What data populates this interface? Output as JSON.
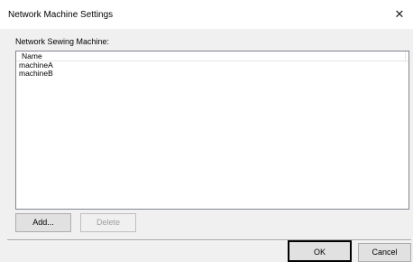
{
  "window": {
    "title": "Network Machine Settings",
    "close_glyph": "✕"
  },
  "group_label": "Network Sewing Machine:",
  "list": {
    "column_header": "Name",
    "items": [
      "machineA",
      "machineB"
    ]
  },
  "buttons": {
    "add": "Add...",
    "delete": "Delete",
    "ok": "OK",
    "cancel": "Cancel"
  }
}
